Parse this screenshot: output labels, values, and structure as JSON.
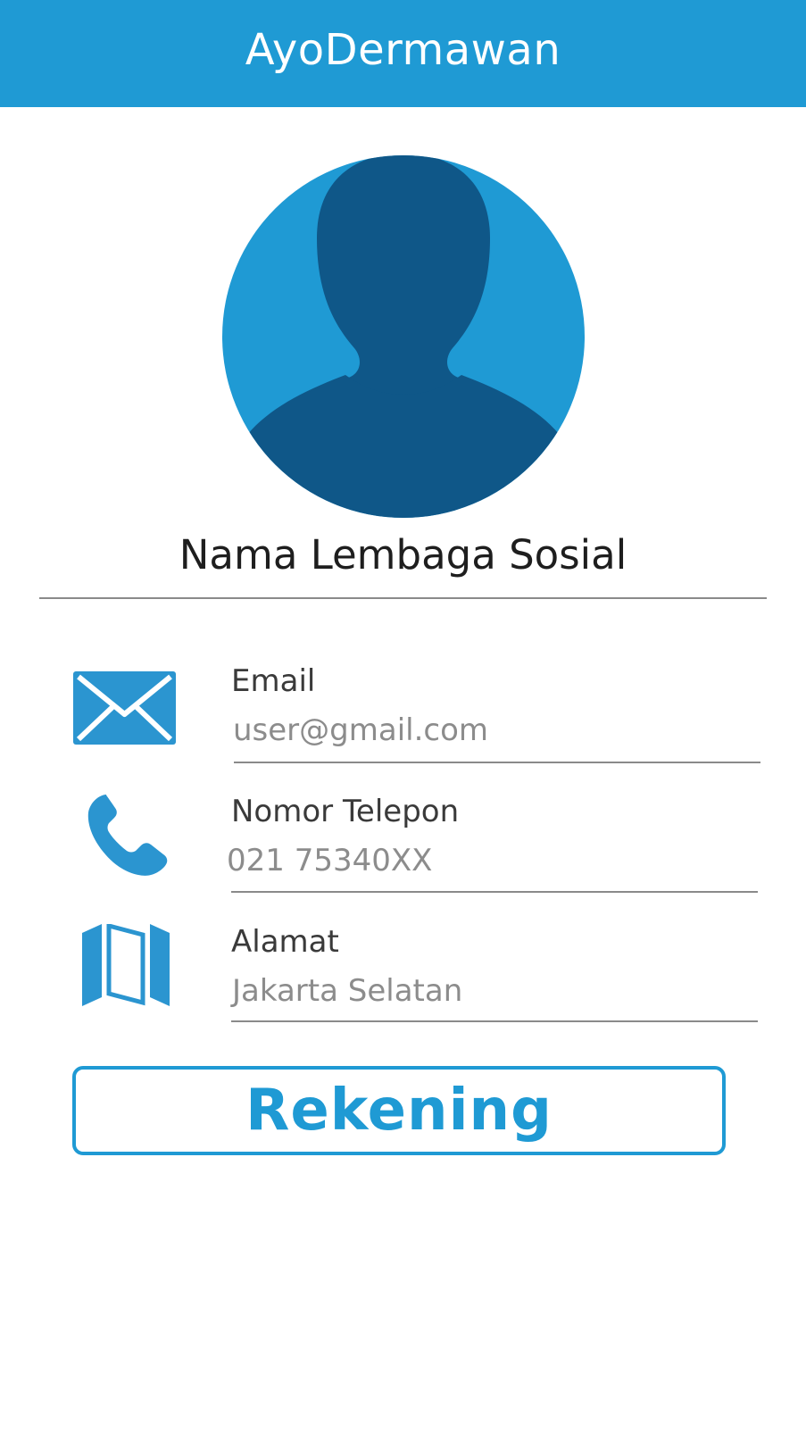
{
  "app": {
    "title": "AyoDermawan",
    "accent_color": "#1f9ad4",
    "avatar_dark_color": "#0f5788"
  },
  "profile": {
    "name": "Nama Lembaga Sosial",
    "avatar_icon": "person-silhouette-icon"
  },
  "fields": [
    {
      "label": "Email",
      "value": "user@gmail.com",
      "icon": "envelope-icon"
    },
    {
      "label": "Nomor Telepon",
      "value": "021 75340XX",
      "icon": "phone-icon"
    },
    {
      "label": "Alamat",
      "value": "Jakarta Selatan",
      "icon": "map-icon"
    }
  ],
  "actions": {
    "rekening_label": "Rekening"
  }
}
